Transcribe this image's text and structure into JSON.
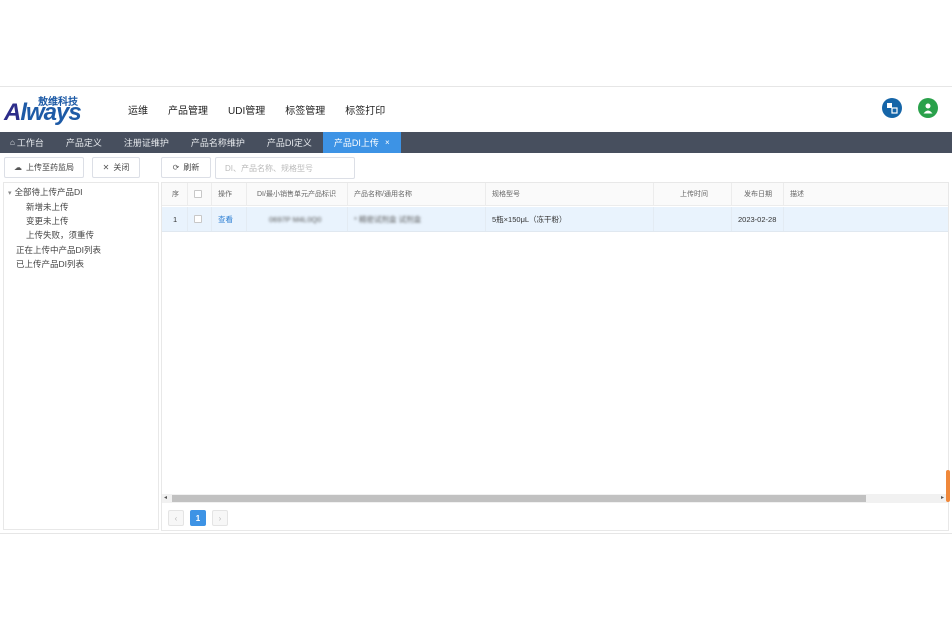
{
  "header": {
    "logo_top": "敖维科技",
    "logo_main_a": "A",
    "logo_main_rest": "lways",
    "nav": [
      "运维",
      "产品管理",
      "UDI管理",
      "标签管理",
      "标签打印"
    ]
  },
  "tabs": [
    {
      "label": "工作台",
      "icon": "home-icon"
    },
    {
      "label": "产品定义"
    },
    {
      "label": "注册证维护"
    },
    {
      "label": "产品名称维护"
    },
    {
      "label": "产品DI定义"
    },
    {
      "label": "产品DI上传",
      "active": true,
      "close": "×"
    }
  ],
  "toolbar": {
    "upload_label": "上传至药监局",
    "close_label": "关闭",
    "refresh_label": "刷新",
    "search_placeholder": "DI、产品名称、规格型号"
  },
  "tree": {
    "root": "全部待上传产品DI",
    "children": [
      "新增未上传",
      "变更未上传",
      "上传失败，须重传"
    ],
    "others": [
      "正在上传中产品DI列表",
      "已上传产品DI列表"
    ]
  },
  "grid": {
    "columns": [
      "序",
      "",
      "操作",
      "DI/最小销售单元产品标识",
      "产品名称/通用名称",
      "规格型号",
      "上传时间",
      "发布日期",
      "描述"
    ],
    "rows": [
      {
        "index": "1",
        "action": "查看",
        "di": "0697P M4L0Q0",
        "name": "* 精密试剂盒 试剂盒",
        "spec": "5瓶×150μL（冻干粉）",
        "upload_time": "",
        "publish_date": "2023-02-28",
        "desc": ""
      }
    ]
  },
  "pager": {
    "prev": "‹",
    "current": "1",
    "next": "›"
  },
  "colors": {
    "accent": "#3d93e5",
    "tabbar": "#474f5e",
    "brand": "#1d5aa6"
  }
}
